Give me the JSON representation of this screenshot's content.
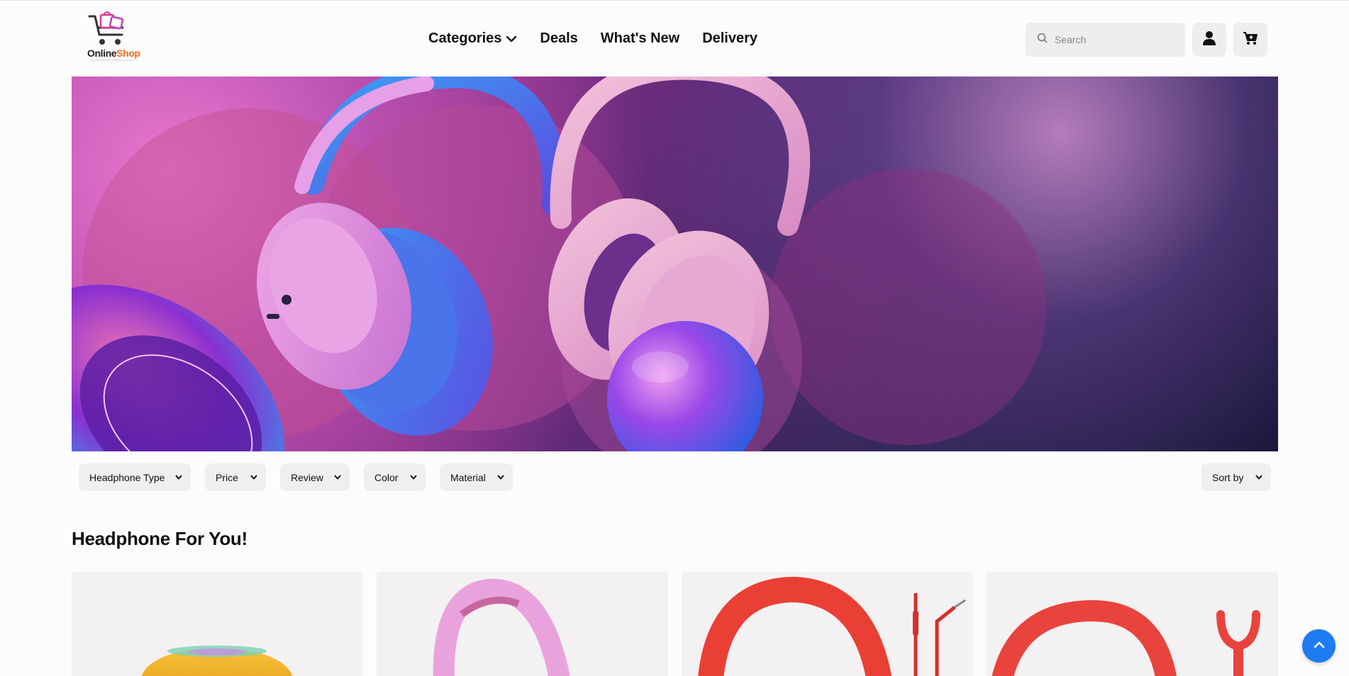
{
  "brand": {
    "name_part1": "Online",
    "name_part2": "Shop"
  },
  "nav": {
    "items": [
      {
        "label": "Categories",
        "has_dropdown": true
      },
      {
        "label": "Deals",
        "has_dropdown": false
      },
      {
        "label": "What's New",
        "has_dropdown": false
      },
      {
        "label": "Delivery",
        "has_dropdown": false
      }
    ]
  },
  "search": {
    "placeholder": "Search",
    "icon": "search-icon"
  },
  "header_actions": {
    "account_icon": "user-icon",
    "cart_icon": "cart-icon"
  },
  "filters": {
    "items": [
      {
        "label": "Headphone Type"
      },
      {
        "label": "Price"
      },
      {
        "label": "Review"
      },
      {
        "label": "Color"
      },
      {
        "label": "Material"
      }
    ],
    "sort_label": "Sort by"
  },
  "section": {
    "title": "Headphone For You!"
  },
  "colors": {
    "accent": "#1d7cf2",
    "brand_orange": "#f26a1b",
    "brand_pink": "#e2358e",
    "chip_bg": "#f0efef"
  },
  "scroll_top": {
    "icon": "chevron-up-icon"
  }
}
